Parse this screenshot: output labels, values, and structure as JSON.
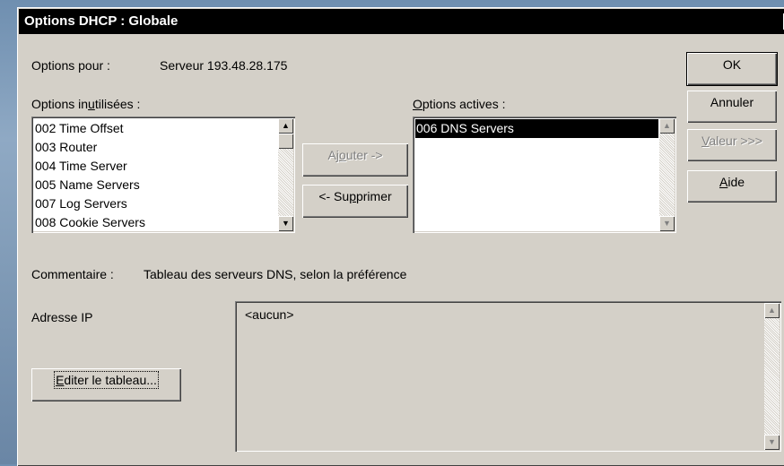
{
  "window": {
    "title": "Options DHCP : Globale",
    "close_glyph": "✕"
  },
  "options_for": {
    "label": "Options pour :",
    "value": "Serveur 193.48.28.175"
  },
  "unused": {
    "label_pre": "Options in",
    "label_u": "u",
    "label_post": "tilisées :",
    "items": [
      "002 Time Offset",
      "003 Router",
      "004 Time Server",
      "005 Name Servers",
      "007 Log Servers",
      "008 Cookie Servers"
    ]
  },
  "active": {
    "label_u": "O",
    "label_post": "ptions actives :",
    "items": [
      "006 DNS Servers"
    ]
  },
  "buttons": {
    "add": {
      "pre": "Aj",
      "u": "o",
      "post": "uter ->"
    },
    "remove": {
      "pre": "<- Su",
      "u": "p",
      "post": "primer"
    },
    "ok": "OK",
    "cancel": "Annuler",
    "value": {
      "u": "V",
      "post": "aleur >>>"
    },
    "help": {
      "u": "A",
      "post": "ide"
    },
    "edit": {
      "u": "E",
      "post": "diter le tableau..."
    }
  },
  "comment": {
    "label": "Commentaire :",
    "value": "Tableau des serveurs DNS, selon la préférence"
  },
  "ip": {
    "label": "Adresse IP",
    "value": "<aucun>"
  },
  "scroll": {
    "up": "▲",
    "down": "▼"
  }
}
